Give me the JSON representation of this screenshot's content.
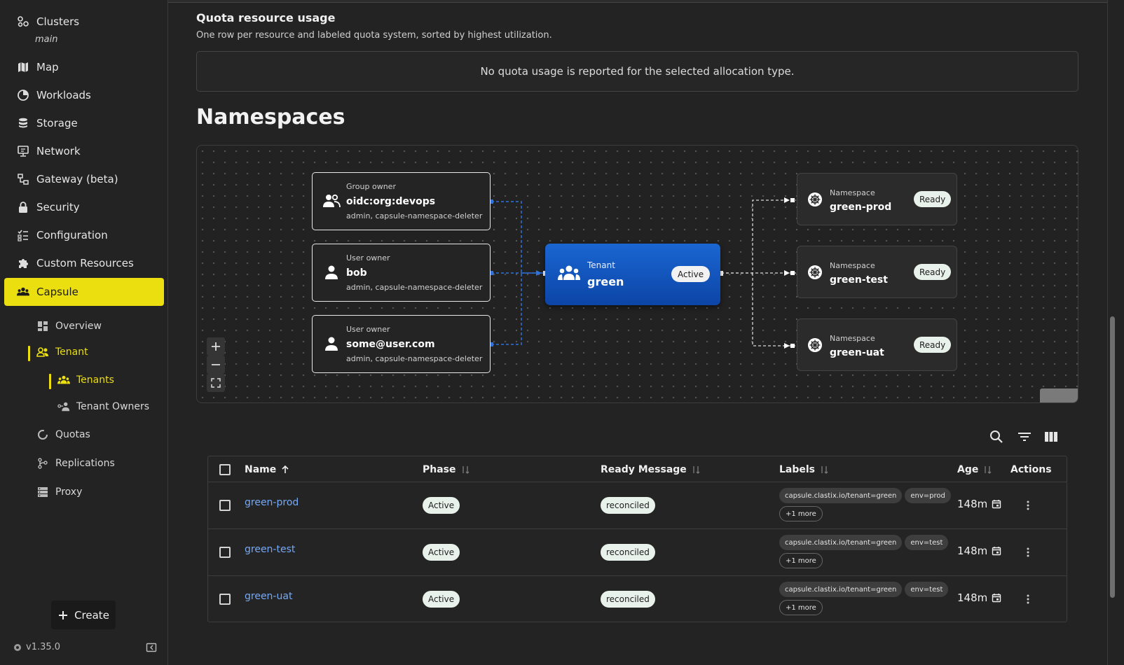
{
  "sidebar": {
    "clusters_label": "Clusters",
    "cluster_name": "main",
    "items": [
      {
        "label": "Map",
        "icon": "map-icon"
      },
      {
        "label": "Workloads",
        "icon": "workloads-icon"
      },
      {
        "label": "Storage",
        "icon": "storage-icon"
      },
      {
        "label": "Network",
        "icon": "network-icon"
      },
      {
        "label": "Gateway (beta)",
        "icon": "gateway-icon"
      },
      {
        "label": "Security",
        "icon": "lock-icon"
      },
      {
        "label": "Configuration",
        "icon": "configuration-icon"
      },
      {
        "label": "Custom Resources",
        "icon": "puzzle-icon"
      },
      {
        "label": "Capsule",
        "icon": "group-icon"
      }
    ],
    "capsule_sub": {
      "overview": "Overview",
      "tenant": "Tenant",
      "tenants": "Tenants",
      "tenant_owners": "Tenant Owners",
      "quotas": "Quotas",
      "replications": "Replications",
      "proxy": "Proxy"
    },
    "create_label": "Create",
    "version": "v1.35.0"
  },
  "quota": {
    "title": "Quota resource usage",
    "subtitle": "One row per resource and labeled quota system, sorted by highest utilization.",
    "empty_message": "No quota usage is reported for the selected allocation type."
  },
  "namespaces_title": "Namespaces",
  "graph": {
    "owners": [
      {
        "kind": "Group owner",
        "name": "oidc:org:devops",
        "roles": "admin, capsule-namespace-deleter",
        "icon": "group-icon"
      },
      {
        "kind": "User owner",
        "name": "bob",
        "roles": "admin, capsule-namespace-deleter",
        "icon": "user-icon"
      },
      {
        "kind": "User owner",
        "name": "some@user.com",
        "roles": "admin, capsule-namespace-deleter",
        "icon": "user-icon"
      }
    ],
    "tenant": {
      "kind": "Tenant",
      "name": "green",
      "status": "Active"
    },
    "namespaces": [
      {
        "kind": "Namespace",
        "name": "green-prod",
        "status": "Ready"
      },
      {
        "kind": "Namespace",
        "name": "green-test",
        "status": "Ready"
      },
      {
        "kind": "Namespace",
        "name": "green-uat",
        "status": "Ready"
      }
    ],
    "colors": {
      "owner_edge": "#2f72e0",
      "namespace_edge": "#d8d8d8",
      "tenant_fill": "#1558c8"
    }
  },
  "table": {
    "columns": {
      "name": "Name",
      "phase": "Phase",
      "ready_message": "Ready Message",
      "labels": "Labels",
      "age": "Age",
      "actions": "Actions"
    },
    "rows": [
      {
        "name": "green-prod",
        "phase": "Active",
        "ready_message": "reconciled",
        "label1": "capsule.clastix.io/tenant=green",
        "label2": "env=prod",
        "more": "+1 more",
        "age": "148m"
      },
      {
        "name": "green-test",
        "phase": "Active",
        "ready_message": "reconciled",
        "label1": "capsule.clastix.io/tenant=green",
        "label2": "env=test",
        "more": "+1 more",
        "age": "148m"
      },
      {
        "name": "green-uat",
        "phase": "Active",
        "ready_message": "reconciled",
        "label1": "capsule.clastix.io/tenant=green",
        "label2": "env=test",
        "more": "+1 more",
        "age": "148m"
      }
    ]
  },
  "theme": {
    "accent": "#ecdf10",
    "link": "#76a9f5",
    "background": "#232323"
  }
}
